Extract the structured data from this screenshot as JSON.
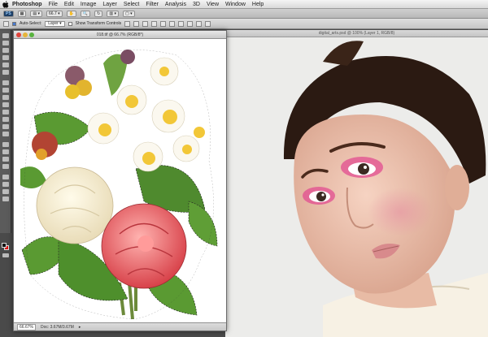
{
  "menubar": {
    "app_name": "Photoshop",
    "items": [
      "File",
      "Edit",
      "Image",
      "Layer",
      "Select",
      "Filter",
      "Analysis",
      "3D",
      "View",
      "Window",
      "Help"
    ]
  },
  "appbar": {
    "app_badge": "PS",
    "zoom": "66.7"
  },
  "options": {
    "auto_select_label": "Auto-Select:",
    "auto_select_value": "Layer",
    "transform_label": "Show Transform Controls"
  },
  "document_front": {
    "title": "018.tif @ 66.7% (RGB/8*)",
    "zoom_readout": "66.67%",
    "doc_size": "Doc: 3.67M/3.67M"
  },
  "document_back": {
    "title": "digital_arts.psd @ 100% (Layer 1, RGB/8)"
  },
  "colors": {
    "foreground": "#111111",
    "background": "#d11111"
  }
}
